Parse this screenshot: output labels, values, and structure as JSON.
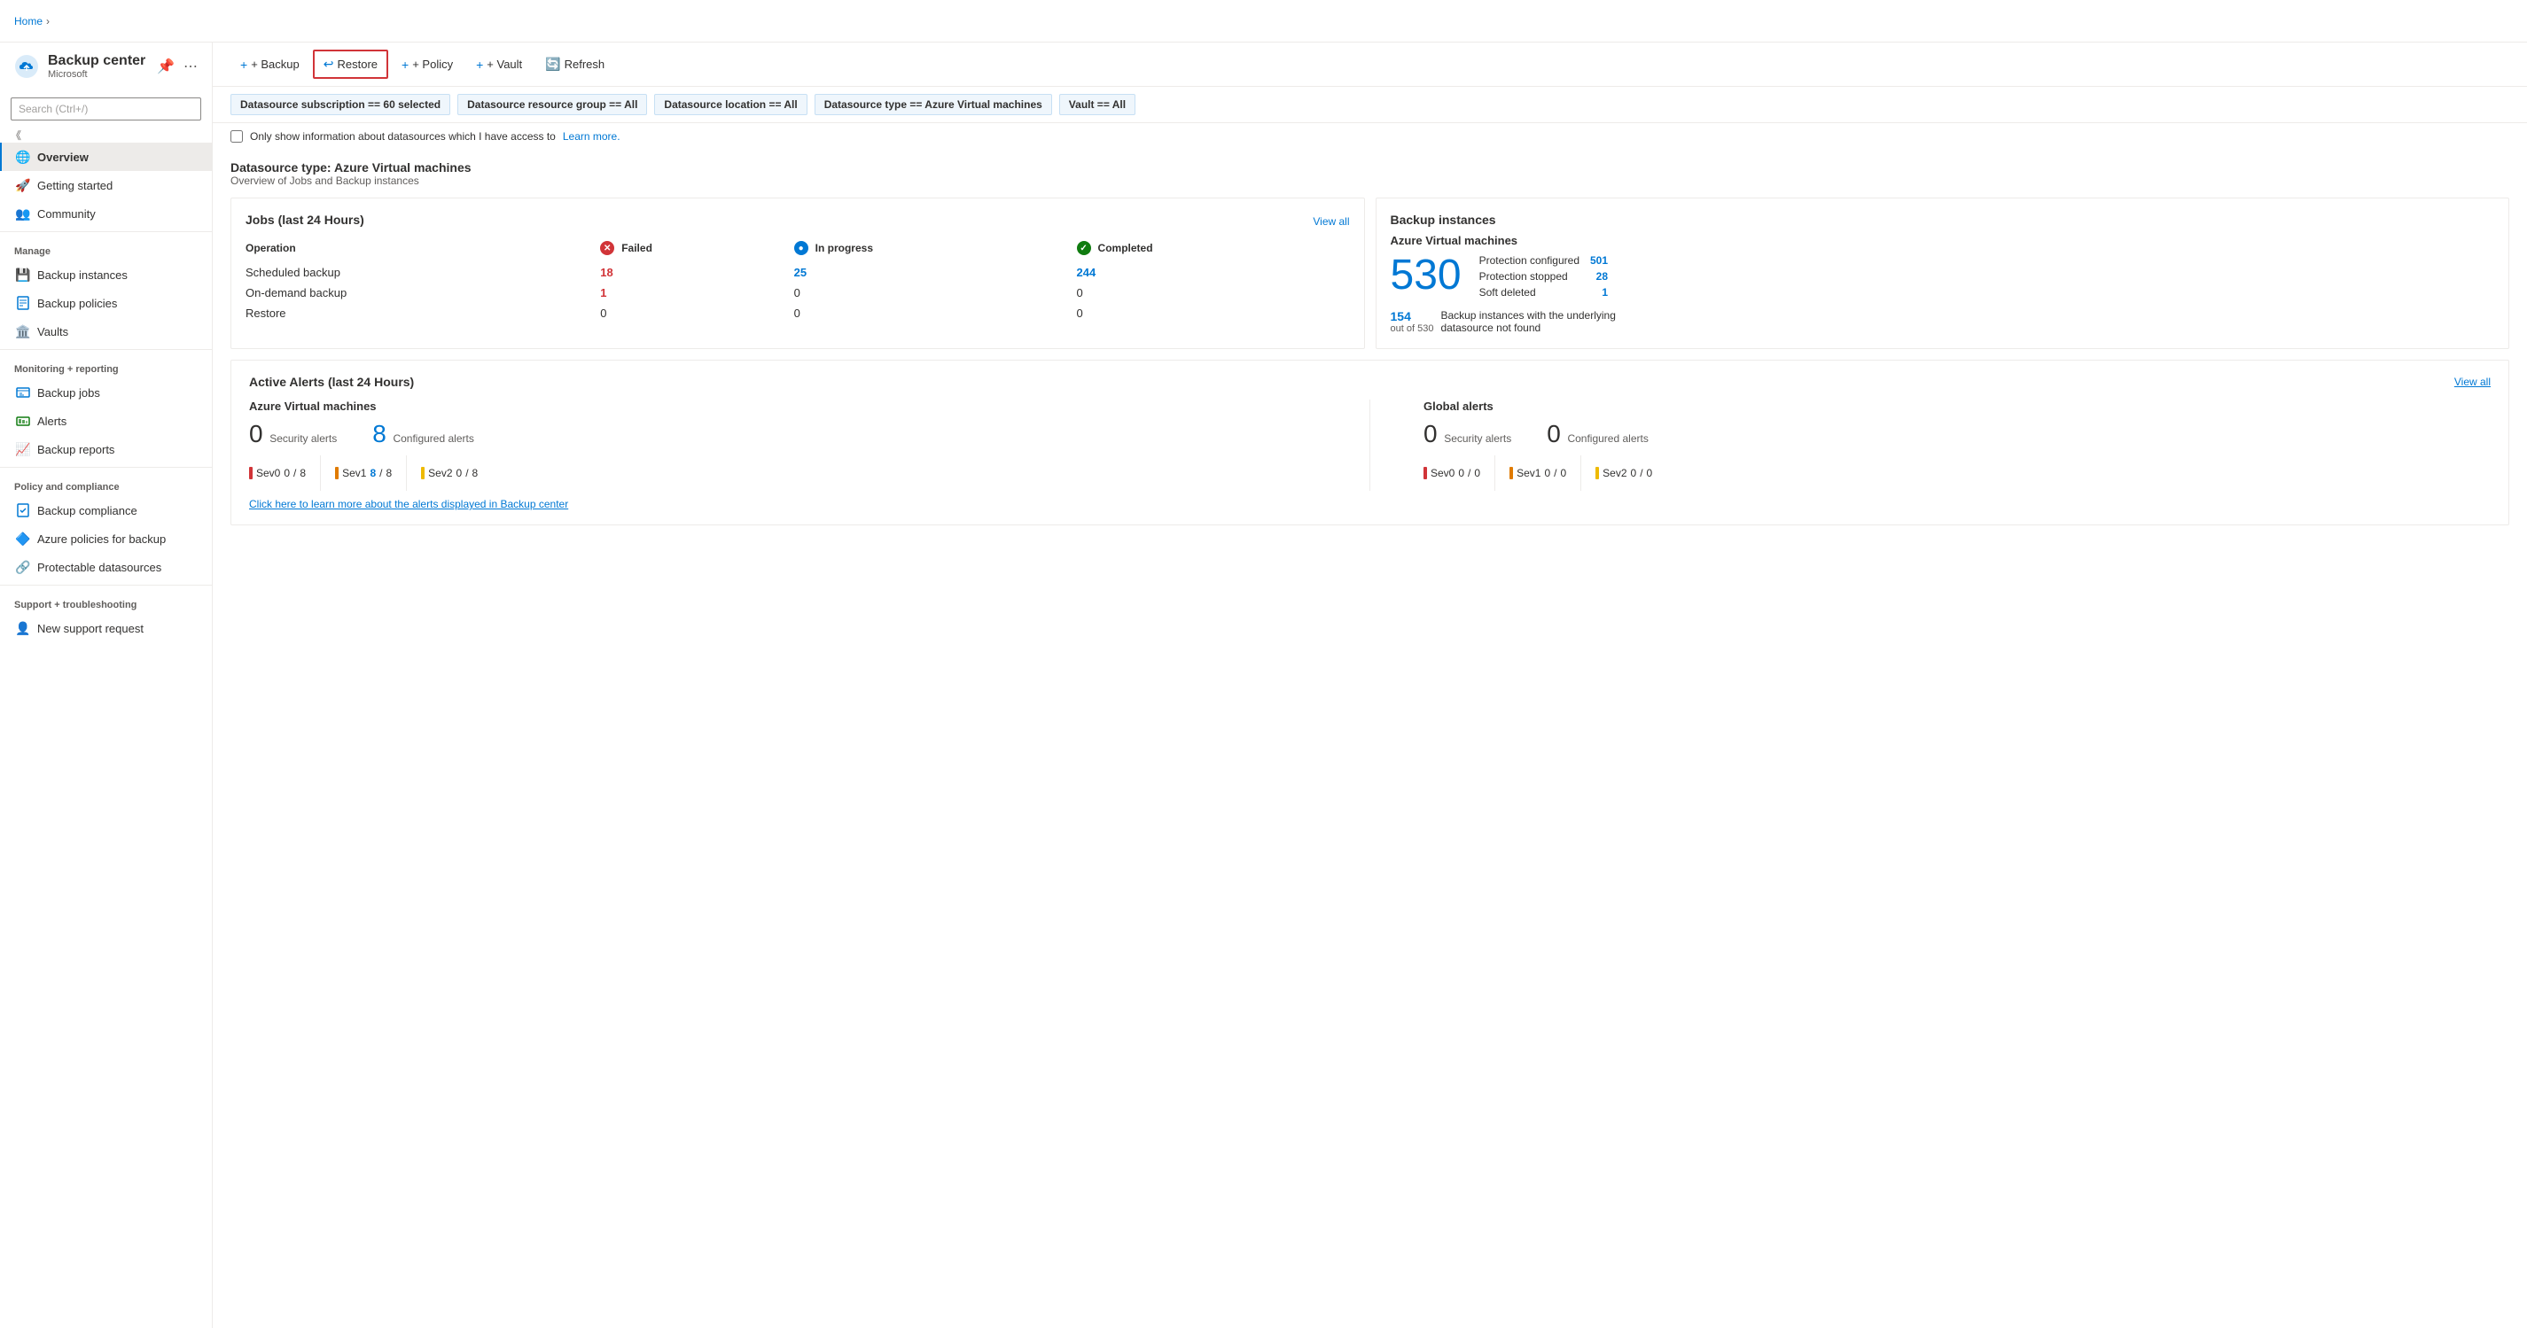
{
  "app": {
    "title": "Backup center",
    "subtitle": "Microsoft",
    "breadcrumb": "Home"
  },
  "toolbar": {
    "backup_label": "+ Backup",
    "restore_label": "Restore",
    "policy_label": "+ Policy",
    "vault_label": "+ Vault",
    "refresh_label": "Refresh"
  },
  "search": {
    "placeholder": "Search (Ctrl+/)"
  },
  "sidebar": {
    "nav_items": [
      {
        "id": "overview",
        "label": "Overview",
        "icon": "🌐",
        "active": true
      },
      {
        "id": "getting-started",
        "label": "Getting started",
        "icon": "🚀",
        "active": false
      },
      {
        "id": "community",
        "label": "Community",
        "icon": "👥",
        "active": false
      }
    ],
    "manage_label": "Manage",
    "manage_items": [
      {
        "id": "backup-instances",
        "label": "Backup instances",
        "icon": "💾"
      },
      {
        "id": "backup-policies",
        "label": "Backup policies",
        "icon": "📋"
      },
      {
        "id": "vaults",
        "label": "Vaults",
        "icon": "🏛️"
      }
    ],
    "monitoring_label": "Monitoring + reporting",
    "monitoring_items": [
      {
        "id": "backup-jobs",
        "label": "Backup jobs",
        "icon": "📄"
      },
      {
        "id": "alerts",
        "label": "Alerts",
        "icon": "📊"
      },
      {
        "id": "backup-reports",
        "label": "Backup reports",
        "icon": "📈"
      }
    ],
    "policy_label": "Policy and compliance",
    "policy_items": [
      {
        "id": "backup-compliance",
        "label": "Backup compliance",
        "icon": "📋"
      },
      {
        "id": "azure-policies",
        "label": "Azure policies for backup",
        "icon": "🔷"
      },
      {
        "id": "protectable-datasources",
        "label": "Protectable datasources",
        "icon": "🔗"
      }
    ],
    "support_label": "Support + troubleshooting",
    "support_items": [
      {
        "id": "new-support",
        "label": "New support request",
        "icon": "👤"
      }
    ]
  },
  "filters": [
    {
      "id": "subscription",
      "text": "Datasource subscription == ",
      "bold": "60 selected"
    },
    {
      "id": "resource-group",
      "text": "Datasource resource group == ",
      "bold": "All"
    },
    {
      "id": "location",
      "text": "Datasource location == ",
      "bold": "All"
    },
    {
      "id": "datasource-type",
      "text": "Datasource type == ",
      "bold": "Azure Virtual machines"
    },
    {
      "id": "vault",
      "text": "Vault == ",
      "bold": "All"
    }
  ],
  "checkbox": {
    "label": "Only show information about datasources which I have access to",
    "link_text": "Learn more."
  },
  "section": {
    "title": "Datasource type: Azure Virtual machines",
    "desc": "Overview of Jobs and Backup instances"
  },
  "jobs_card": {
    "title": "Jobs (last 24 Hours)",
    "view_all": "View all",
    "headers": {
      "operation": "Operation",
      "failed": "Failed",
      "in_progress": "In progress",
      "completed": "Completed"
    },
    "rows": [
      {
        "operation": "Scheduled backup",
        "failed": "18",
        "failed_blue": false,
        "in_progress": "25",
        "completed": "244"
      },
      {
        "operation": "On-demand backup",
        "failed": "1",
        "failed_blue": false,
        "in_progress": "0",
        "completed": "0"
      },
      {
        "operation": "Restore",
        "failed": "0",
        "failed_blue": false,
        "in_progress": "0",
        "completed": "0"
      }
    ]
  },
  "backup_card": {
    "title": "Backup instances",
    "type": "Azure Virtual machines",
    "big_number": "530",
    "stats": [
      {
        "label": "Protection configured",
        "value": "501"
      },
      {
        "label": "Protection stopped",
        "value": "28"
      },
      {
        "label": "Soft deleted",
        "value": "1"
      }
    ],
    "sub_number": "154",
    "sub_label": "out of 530",
    "sub_desc": "Backup instances with the underlying datasource not found"
  },
  "alerts_card": {
    "title": "Active Alerts (last 24 Hours)",
    "view_all": "View all",
    "azure_section": {
      "title": "Azure Virtual machines",
      "security_count": "0",
      "security_label": "Security alerts",
      "configured_count": "8",
      "configured_label": "Configured alerts",
      "sev_items": [
        {
          "level": "Sev0",
          "current": "0",
          "total": "8",
          "color": "sev0-color"
        },
        {
          "level": "Sev1",
          "current": "8",
          "total": "8",
          "color": "sev1-color",
          "highlight": true
        },
        {
          "level": "Sev2",
          "current": "0",
          "total": "8",
          "color": "sev2-color"
        }
      ]
    },
    "global_section": {
      "title": "Global alerts",
      "security_count": "0",
      "security_label": "Security alerts",
      "configured_count": "0",
      "configured_label": "Configured alerts",
      "sev_items": [
        {
          "level": "Sev0",
          "current": "0",
          "total": "0",
          "color": "sev0-color"
        },
        {
          "level": "Sev1",
          "current": "0",
          "total": "0",
          "color": "sev1-color"
        },
        {
          "level": "Sev2",
          "current": "0",
          "total": "0",
          "color": "sev2-color"
        }
      ]
    },
    "info_link": "Click here to learn more about the alerts displayed in Backup center"
  }
}
